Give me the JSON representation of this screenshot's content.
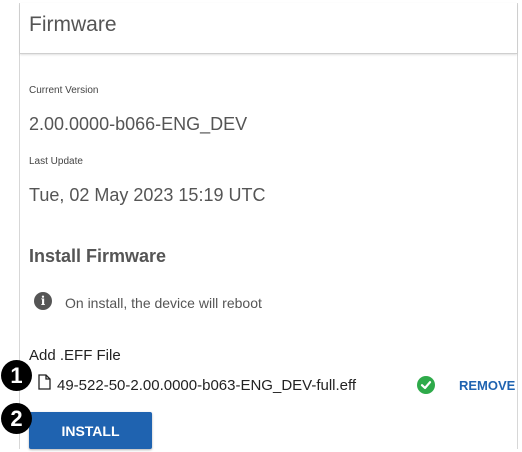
{
  "panel": {
    "title": "Firmware",
    "current_version_label": "Current Version",
    "current_version_value": "2.00.0000-b066-ENG_DEV",
    "last_update_label": "Last Update",
    "last_update_value": "Tue, 02 May 2023 15:19 UTC"
  },
  "install": {
    "section_title": "Install Firmware",
    "info_icon": "i",
    "info_text": "On install, the device will reboot",
    "add_file_label": "Add .EFF File",
    "file_name": "49-522-50-2.00.0000-b063-ENG_DEV-full.eff",
    "remove_label": "REMOVE",
    "install_button_label": "INSTALL"
  },
  "callouts": [
    "1",
    "2"
  ],
  "colors": {
    "accent": "#1f63b0",
    "success": "#2eaa4a"
  }
}
